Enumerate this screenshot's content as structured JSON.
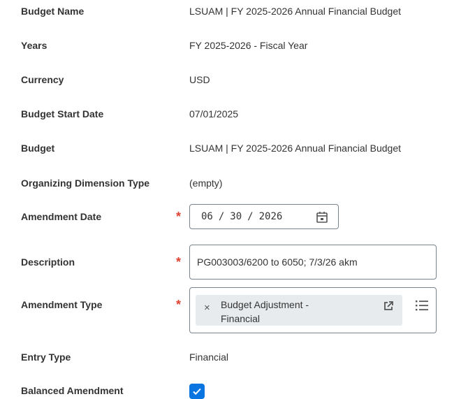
{
  "fields": {
    "budget_name": {
      "label": "Budget Name",
      "value": "LSUAM | FY 2025-2026 Annual Financial Budget"
    },
    "years": {
      "label": "Years",
      "value": "FY 2025-2026 - Fiscal Year"
    },
    "currency": {
      "label": "Currency",
      "value": "USD"
    },
    "budget_start_date": {
      "label": "Budget Start Date",
      "value": "07/01/2025"
    },
    "budget": {
      "label": "Budget",
      "value": "LSUAM | FY 2025-2026 Annual Financial Budget"
    },
    "organizing_dimension_type": {
      "label": "Organizing Dimension Type",
      "value": "(empty)"
    },
    "amendment_date": {
      "label": "Amendment Date",
      "required_mark": "*",
      "month": "06",
      "day": "30",
      "year": "2026",
      "separator": "/",
      "icon": "calendar-icon"
    },
    "description": {
      "label": "Description",
      "required_mark": "*",
      "value": "PG003003/6200 to 6050; 7/3/26 akm"
    },
    "amendment_type": {
      "label": "Amendment Type",
      "required_mark": "*",
      "selected_line1": "Budget Adjustment -",
      "selected_line2": "Financial",
      "remove_glyph": "×",
      "icons": [
        "remove-icon",
        "open-link-icon",
        "list-icon"
      ]
    },
    "entry_type": {
      "label": "Entry Type",
      "value": "Financial"
    },
    "balanced_amendment": {
      "label": "Balanced Amendment",
      "checked": true
    }
  },
  "colors": {
    "required": "#de4331",
    "checkbox": "#0875e1",
    "border": "#7b838b",
    "pill": "#e8ebee"
  }
}
